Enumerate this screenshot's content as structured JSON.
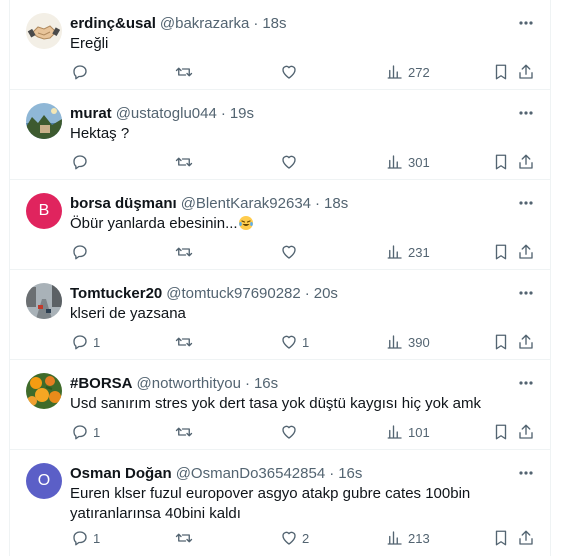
{
  "tweets": [
    {
      "name": "erdinç&usal",
      "handle": "@bakrazarka",
      "time": "18s",
      "text": "Ereğli",
      "replies": "",
      "retweets": "",
      "likes": "",
      "views": "272",
      "avatar": {
        "type": "image",
        "bg": "#f5f0e6"
      }
    },
    {
      "name": "murat",
      "handle": "@ustatoglu044",
      "time": "19s",
      "text": "Hektaş ?",
      "replies": "",
      "retweets": "",
      "likes": "",
      "views": "301",
      "avatar": {
        "type": "image",
        "bg": "#7aa7c7"
      }
    },
    {
      "name": "borsa düşmanı",
      "handle": "@BlentKarak92634",
      "time": "18s",
      "text": "Öbür yanlarda ebesinin...",
      "replies": "",
      "retweets": "",
      "likes": "",
      "views": "231",
      "avatar": {
        "type": "letter",
        "letter": "B",
        "bg": "#e0245e"
      }
    },
    {
      "name": "Tomtucker20",
      "handle": "@tomtuck97690282",
      "time": "20s",
      "text": "klseri de yazsana",
      "replies": "1",
      "retweets": "",
      "likes": "1",
      "views": "390",
      "avatar": {
        "type": "image",
        "bg": "#8a8f94"
      }
    },
    {
      "name": "#BORSA",
      "handle": "@notworthityou",
      "time": "16s",
      "text": "Usd sanırım stres yok dert tasa yok düştü kaygısı hiç yok amk",
      "replies": "1",
      "retweets": "",
      "likes": "",
      "views": "101",
      "avatar": {
        "type": "image",
        "bg": "#3f6b2a"
      }
    },
    {
      "name": "Osman Doğan",
      "handle": "@OsmanDo36542854",
      "time": "16s",
      "text": "Euren klser fuzul europover asgyo atakp gubre cates 100bin yatıranlarınsa 40bini kaldı",
      "replies": "1",
      "retweets": "",
      "likes": "2",
      "views": "213",
      "avatar": {
        "type": "letter",
        "letter": "O",
        "bg": "#5b5fc7"
      }
    }
  ],
  "icons": {
    "more": "more-dots-icon",
    "reply": "reply-icon",
    "retweet": "retweet-icon",
    "like": "heart-icon",
    "views": "views-icon",
    "bookmark": "bookmark-icon",
    "share": "share-icon"
  },
  "colors": {
    "text": "#0f1419",
    "secondary": "#536471",
    "divider": "#eff3f4"
  }
}
